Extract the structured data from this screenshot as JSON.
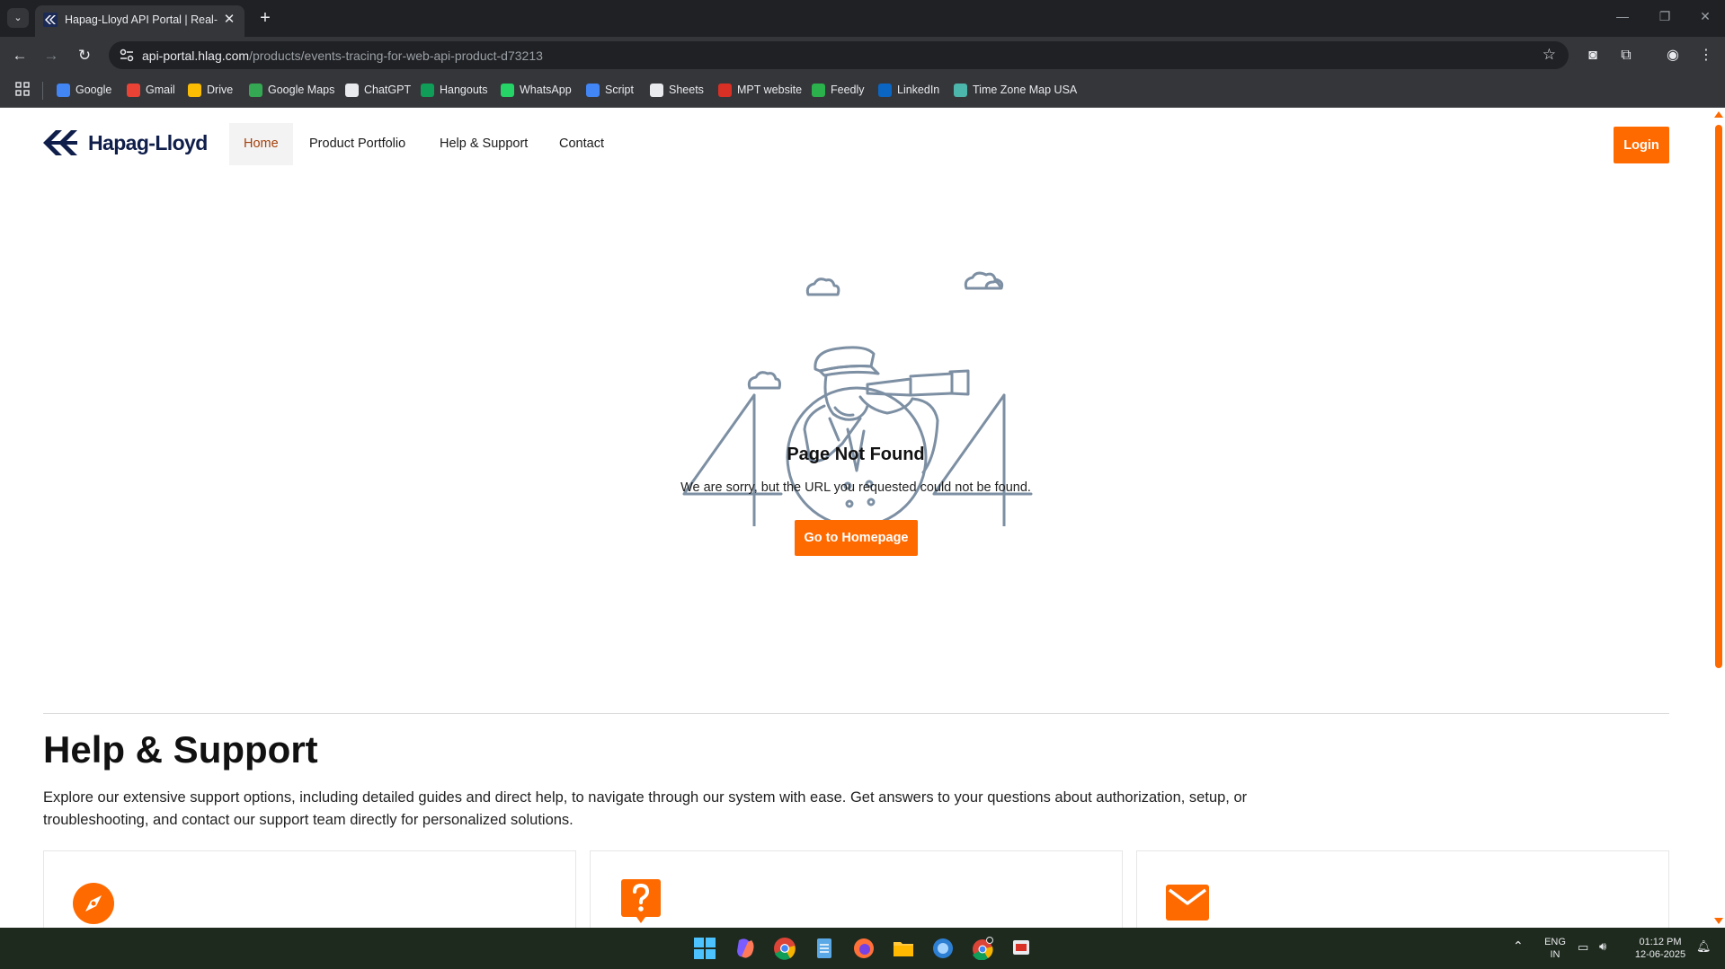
{
  "browser": {
    "tab_title": "Hapag-Lloyd API Portal | Real-T",
    "url_host": "api-portal.hlag.com",
    "url_path": "/products/events-tracing-for-web-api-product-d73213",
    "bookmarks": [
      {
        "label": "Google",
        "icon": "google-icon",
        "color": "#4285f4"
      },
      {
        "label": "Gmail",
        "icon": "gmail-icon",
        "color": "#ea4335"
      },
      {
        "label": "Drive",
        "icon": "drive-icon",
        "color": "#fbbc04"
      },
      {
        "label": "Google Maps",
        "icon": "maps-icon",
        "color": "#34a853"
      },
      {
        "label": "ChatGPT",
        "icon": "chatgpt-icon",
        "color": "#e8eaed"
      },
      {
        "label": "Hangouts",
        "icon": "hangouts-icon",
        "color": "#0f9d58"
      },
      {
        "label": "WhatsApp",
        "icon": "whatsapp-icon",
        "color": "#25d366"
      },
      {
        "label": "Script",
        "icon": "script-icon",
        "color": "#4285f4"
      },
      {
        "label": "Sheets",
        "icon": "folder-icon",
        "color": "#e8eaed"
      },
      {
        "label": "MPT website",
        "icon": "mpt-icon",
        "color": "#d93025"
      },
      {
        "label": "Feedly",
        "icon": "feedly-icon",
        "color": "#2bb24c"
      },
      {
        "label": "LinkedIn",
        "icon": "linkedin-icon",
        "color": "#0a66c2"
      },
      {
        "label": "Time Zone Map USA",
        "icon": "timezone-icon",
        "color": "#4db6ac"
      }
    ]
  },
  "header": {
    "logo_text": "Hapag-Lloyd",
    "nav": [
      {
        "label": "Home",
        "active": true
      },
      {
        "label": "Product Portfolio",
        "active": false
      },
      {
        "label": "Help & Support",
        "active": false
      },
      {
        "label": "Contact",
        "active": false
      }
    ],
    "login_label": "Login"
  },
  "not_found": {
    "title": "Page Not Found",
    "message": "We are sorry, but the URL you requested could not be found.",
    "button_label": "Go to Homepage"
  },
  "help_support": {
    "title": "Help & Support",
    "description": "Explore our extensive support options, including detailed guides and direct help, to navigate through our system with ease. Get answers to your questions about authorization, setup, or troubleshooting, and contact our support team directly for personalized solutions.",
    "cards": [
      {
        "icon": "compass-icon"
      },
      {
        "icon": "question-icon"
      },
      {
        "icon": "mail-icon"
      }
    ]
  },
  "taskbar": {
    "lang_line1": "ENG",
    "lang_line2": "IN",
    "time": "01:12 PM",
    "date": "12-06-2025"
  },
  "colors": {
    "accent": "#ff6a00",
    "brand_navy": "#0f1e4a",
    "illustration": "#7d8fa3"
  }
}
